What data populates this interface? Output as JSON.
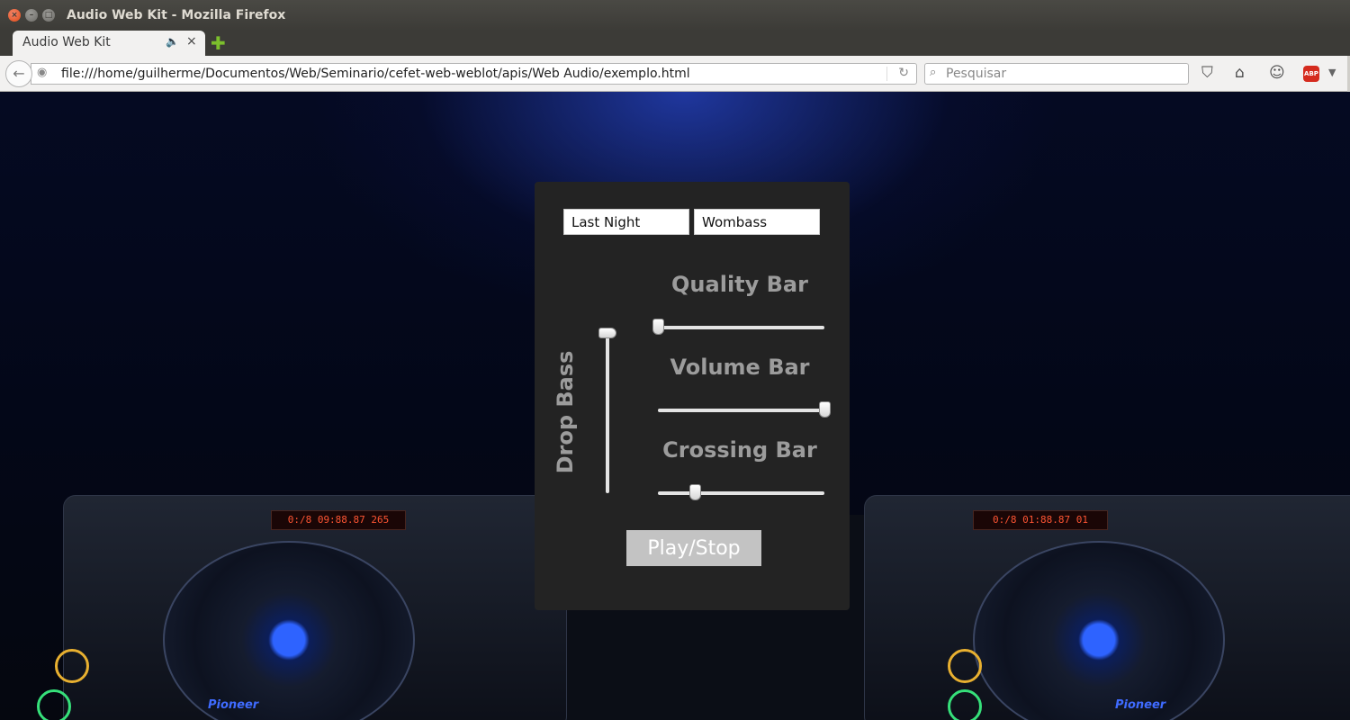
{
  "window": {
    "title": "Audio Web Kit - Mozilla Firefox",
    "buttons": {
      "close": "×",
      "minimize": "–",
      "maximize": "□"
    }
  },
  "tabs": [
    {
      "label": "Audio Web Kit",
      "audio_icon": "🔈",
      "close": "×"
    }
  ],
  "new_tab": "✚",
  "navbar": {
    "back": "←",
    "url": "file:///home/guilherme/Documentos/Web/Seminario/cefet-web-weblot/apis/Web Audio/exemplo.html",
    "reload": "↻",
    "search_placeholder": "Pesquisar",
    "abp_label": "ABP",
    "icons": [
      "back-icon",
      "globe-icon",
      "reload-icon",
      "search-icon",
      "pocket-icon",
      "home-icon",
      "chat-icon",
      "adblock-icon",
      "menu-caret-icon"
    ]
  },
  "background": {
    "left_display": "0:/8  09:88.87  265",
    "right_display": "0:/8  01:88.87  01",
    "brand": "Pioneer"
  },
  "player": {
    "track1": "Last Night",
    "track2": "Wombass",
    "quality_label": "Quality Bar",
    "quality_value": 0.0,
    "volume_label": "Volume Bar",
    "volume_value": 1.0,
    "crossing_label": "Crossing Bar",
    "crossing_value": 0.22,
    "drop_bass_label": "Drop Bass",
    "drop_bass_value": 1.0,
    "play_label": "Play/Stop"
  },
  "colors": {
    "panel_bg": "#232323",
    "label_gray": "#9c9c9c",
    "button_bg": "#c3c3c3",
    "ubuntu_close": "#df4a16"
  }
}
